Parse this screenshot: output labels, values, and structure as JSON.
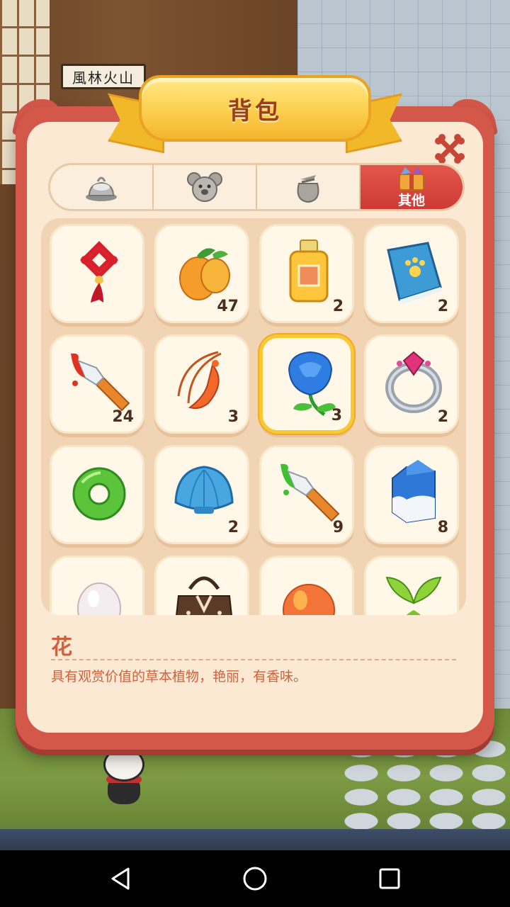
{
  "background": {
    "sign_text": "風林火山"
  },
  "panel": {
    "title": "背包",
    "accent_color": "#d4584a",
    "ribbon_color": "#fdd455"
  },
  "tabs": [
    {
      "label": "",
      "icon": "food-plate-icon",
      "active": false
    },
    {
      "label": "",
      "icon": "koala-icon",
      "active": false
    },
    {
      "label": "",
      "icon": "money-bag-icon",
      "active": false
    },
    {
      "label": "其他",
      "icon": "gift-box-icon",
      "active": true
    }
  ],
  "items": [
    {
      "name": "chinese-knot",
      "count": ""
    },
    {
      "name": "mango",
      "count": "47"
    },
    {
      "name": "perfume",
      "count": "2"
    },
    {
      "name": "paw-book",
      "count": "2"
    },
    {
      "name": "red-paintbrush",
      "count": "24"
    },
    {
      "name": "shrimp-pendant",
      "count": "3"
    },
    {
      "name": "blue-rose",
      "count": "3"
    },
    {
      "name": "ruby-ring",
      "count": "2"
    },
    {
      "name": "green-ring",
      "count": ""
    },
    {
      "name": "blue-shell",
      "count": "2"
    },
    {
      "name": "green-paintbrush",
      "count": "9"
    },
    {
      "name": "milk-carton",
      "count": "8"
    },
    {
      "name": "egg",
      "count": ""
    },
    {
      "name": "leather-bag",
      "count": ""
    },
    {
      "name": "peach",
      "count": ""
    },
    {
      "name": "mint-leaf",
      "count": ""
    }
  ],
  "selected_index": 6,
  "description": {
    "title": "花",
    "text": "具有观赏价值的草本植物，艳丽，有香味。"
  }
}
